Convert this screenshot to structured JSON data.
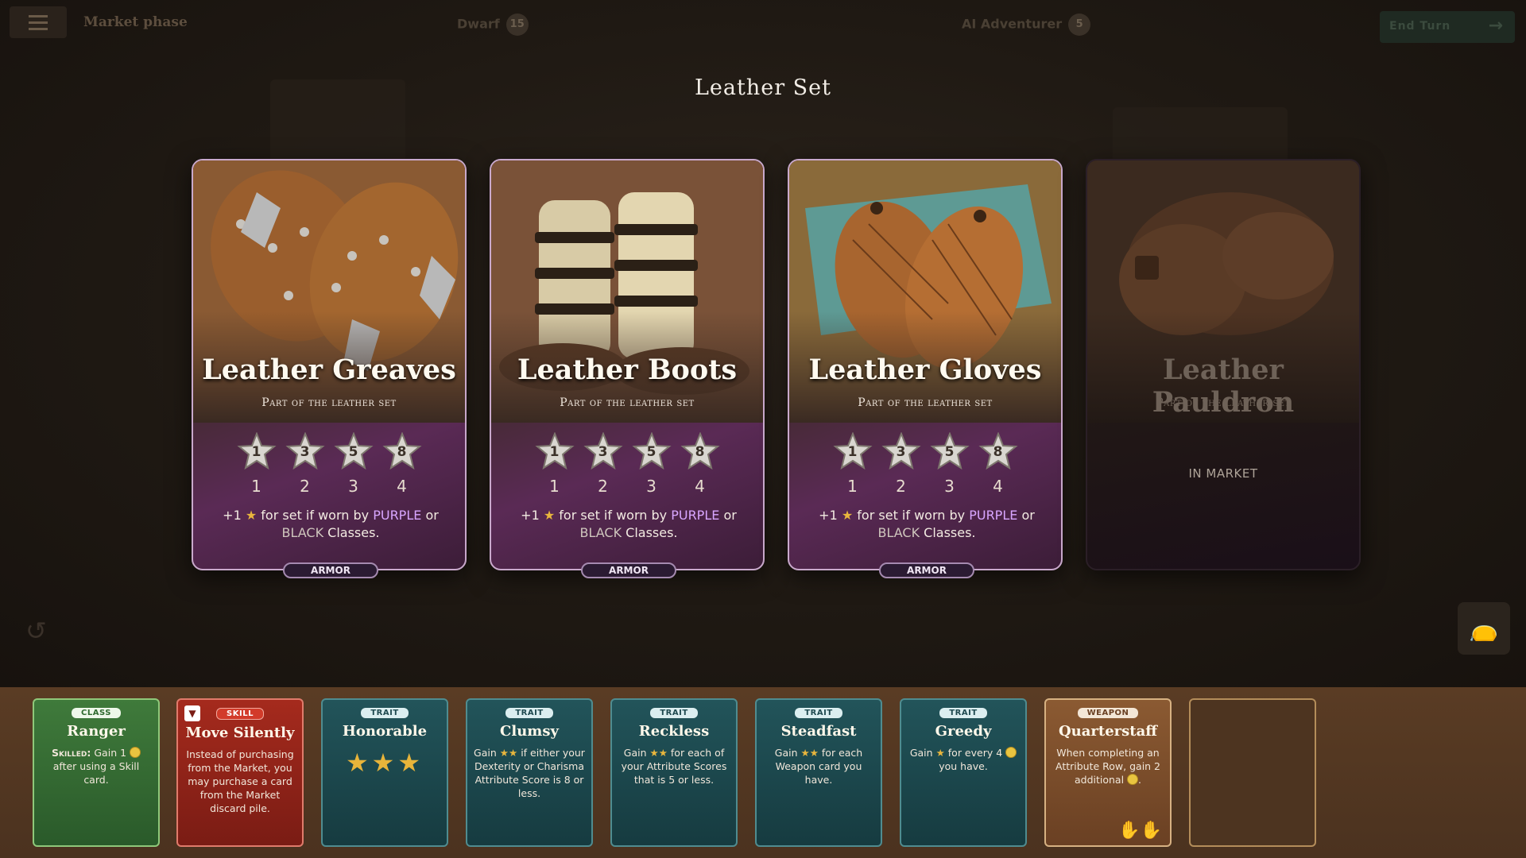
{
  "topbar": {
    "phase": "Market phase",
    "players": [
      {
        "name": "Dwarf",
        "badge": "15"
      },
      {
        "name": "AI Adventurer",
        "badge": "5"
      }
    ],
    "end_turn": "End Turn"
  },
  "modal": {
    "title": "Leather Set",
    "cards": [
      {
        "name": "Leather Greaves",
        "subtitle": "Part of the leather set",
        "star_values": [
          "1",
          "3",
          "5",
          "8"
        ],
        "star_indices": [
          "1",
          "2",
          "3",
          "4"
        ],
        "bonus_prefix": "+1",
        "bonus_mid": "for set if worn by",
        "bonus_purple": "PURPLE",
        "bonus_or": "or",
        "bonus_black": "BLACK",
        "bonus_end": "Classes.",
        "tag": "ARMOR",
        "state": "owned"
      },
      {
        "name": "Leather Boots",
        "subtitle": "Part of the leather set",
        "star_values": [
          "1",
          "3",
          "5",
          "8"
        ],
        "star_indices": [
          "1",
          "2",
          "3",
          "4"
        ],
        "bonus_prefix": "+1",
        "bonus_mid": "for set if worn by",
        "bonus_purple": "PURPLE",
        "bonus_or": "or",
        "bonus_black": "BLACK",
        "bonus_end": "Classes.",
        "tag": "ARMOR",
        "state": "owned"
      },
      {
        "name": "Leather Gloves",
        "subtitle": "Part of the leather set",
        "star_values": [
          "1",
          "3",
          "5",
          "8"
        ],
        "star_indices": [
          "1",
          "2",
          "3",
          "4"
        ],
        "bonus_prefix": "+1",
        "bonus_mid": "for set if worn by",
        "bonus_purple": "PURPLE",
        "bonus_or": "or",
        "bonus_black": "BLACK",
        "bonus_end": "Classes.",
        "tag": "ARMOR",
        "state": "owned"
      },
      {
        "name": "Leather Pauldron",
        "subtitle": "Part of the leather set",
        "status": "IN MARKET",
        "state": "market"
      }
    ]
  },
  "hand": [
    {
      "tag": "CLASS",
      "title": "Ranger",
      "text_bold": "Skilled:",
      "text": "Gain 1",
      "text2": "after using a Skill card.",
      "color": "green"
    },
    {
      "tag": "SKILL",
      "title": "Move Silently",
      "text": "Instead of purchasing from the Market, you may purchase a card from the Market discard pile.",
      "color": "red"
    },
    {
      "tag": "TRAIT",
      "title": "Honorable",
      "stars": "★★★",
      "color": "teal"
    },
    {
      "tag": "TRAIT",
      "title": "Clumsy",
      "text": "Gain",
      "text2": "if either your Dexterity or Charisma Attribute Score is 8 or less.",
      "color": "teal"
    },
    {
      "tag": "TRAIT",
      "title": "Reckless",
      "text": "Gain",
      "text2": "for each of your Attribute Scores that is 5 or less.",
      "color": "teal"
    },
    {
      "tag": "TRAIT",
      "title": "Steadfast",
      "text": "Gain",
      "text2": "for each Weapon card you have.",
      "color": "teal"
    },
    {
      "tag": "TRAIT",
      "title": "Greedy",
      "text": "Gain",
      "text2": "for every 4",
      "text3": "you have.",
      "color": "teal"
    },
    {
      "tag": "WEAPON",
      "title": "Quarterstaff",
      "text": "When completing an Attribute Row, gain 2 additional",
      "color": "brown"
    }
  ],
  "colors": {
    "accent_purple": "#d8a6ff",
    "gold": "#e9b63d",
    "armor_border": "#c9a9cc"
  }
}
